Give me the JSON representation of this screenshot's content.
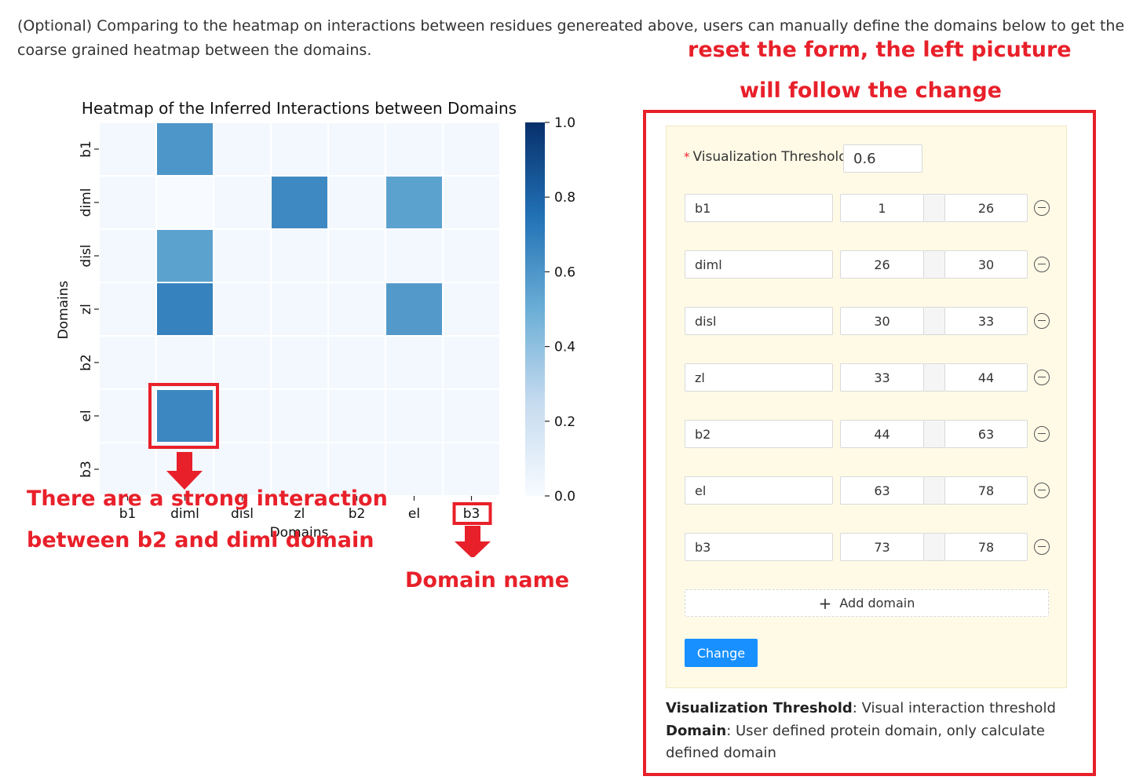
{
  "intro": {
    "text": "(Optional) Comparing to the heatmap on interactions between residues genereated above, users can manually define the domains below to get the coarse grained heatmap between the domains."
  },
  "annotations": {
    "reset_line1": "reset the form, the left picuture",
    "reset_line2": "will follow the change",
    "strong_line1": "There are a strong interaction",
    "strong_line2": "between b2 and diml domain",
    "domain_name": "Domain name",
    "color": "#e8202a"
  },
  "chart_data": {
    "type": "heatmap",
    "title": "Heatmap of the Inferred Interactions between Domains",
    "xlabel": "Domains",
    "ylabel": "Domains",
    "x_categories": [
      "b1",
      "diml",
      "disl",
      "zl",
      "b2",
      "el",
      "b3"
    ],
    "y_categories": [
      "b1",
      "diml",
      "disl",
      "zl",
      "b2",
      "el",
      "b3"
    ],
    "values": [
      [
        0.02,
        0.6,
        0.02,
        0.02,
        0.02,
        0.02,
        0.02
      ],
      [
        0.02,
        0.0,
        0.02,
        0.65,
        0.02,
        0.55,
        0.02
      ],
      [
        0.02,
        0.55,
        0.02,
        0.02,
        0.02,
        0.02,
        0.02
      ],
      [
        0.02,
        0.68,
        0.02,
        0.02,
        0.02,
        0.58,
        0.02
      ],
      [
        0.02,
        0.02,
        0.02,
        0.02,
        0.02,
        0.02,
        0.02
      ],
      [
        0.02,
        0.66,
        0.02,
        0.02,
        0.02,
        0.02,
        0.02
      ],
      [
        0.02,
        0.02,
        0.02,
        0.02,
        0.02,
        0.02,
        0.02
      ]
    ],
    "vmin": 0.0,
    "vmax": 1.0,
    "colorbar_ticks": [
      "0.0",
      "0.2",
      "0.4",
      "0.6",
      "0.8",
      "1.0"
    ],
    "colormap": "Blues",
    "highlighted_cell": {
      "row": 5,
      "col": 1
    },
    "highlighted_xtick": 6
  },
  "form": {
    "threshold_label": "Visualization Threshold",
    "threshold_colon": ":",
    "required_mark": "*",
    "threshold_value": "0.6",
    "domains": [
      {
        "name": "b1",
        "start": "1",
        "end": "26"
      },
      {
        "name": "diml",
        "start": "26",
        "end": "30"
      },
      {
        "name": "disl",
        "start": "30",
        "end": "33"
      },
      {
        "name": "zl",
        "start": "33",
        "end": "44"
      },
      {
        "name": "b2",
        "start": "44",
        "end": "63"
      },
      {
        "name": "el",
        "start": "63",
        "end": "78"
      },
      {
        "name": "b3",
        "start": "73",
        "end": "78"
      }
    ],
    "add_domain_label": "Add domain",
    "add_icon": "+",
    "change_label": "Change",
    "primary_color": "#1890ff"
  },
  "description": {
    "threshold_term": "Visualization Threshold",
    "threshold_text": ": Visual interaction threshold",
    "domain_term": "Domain",
    "domain_text": ": User defined protein domain, only calculate defined domain"
  }
}
